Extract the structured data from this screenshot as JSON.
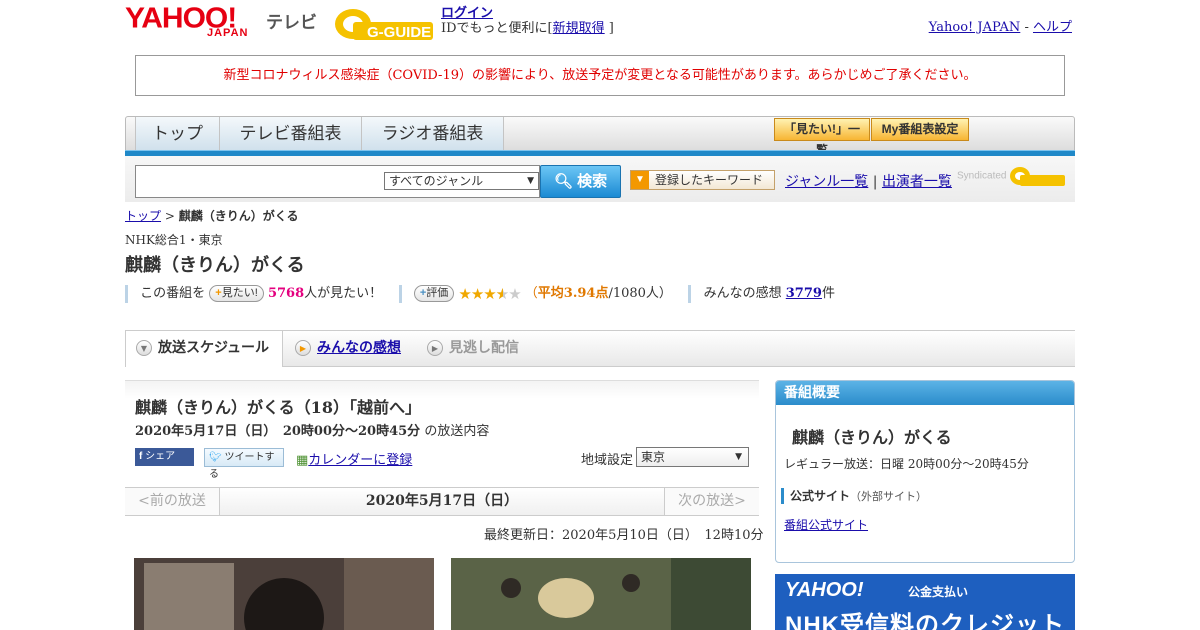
{
  "header": {
    "logo_yahoo": "YAHOO!",
    "logo_japan": "JAPAN",
    "logo_tv": "テレビ",
    "logo_gguide": "G-GUIDE",
    "login": "ログイン",
    "login_sub_prefix": "IDでもっと便利に[",
    "register": "新規取得",
    "login_sub_suffix": "]",
    "yahoo_japan_link": "Yahoo! JAPAN",
    "separator": "-",
    "help_link": "ヘルプ"
  },
  "notice": "新型コロナウィルス感染症（COVID-19）の影響により、放送予定が変更となる可能性があります。あらかじめご了承ください。",
  "nav": {
    "tabs": [
      "トップ",
      "テレビ番組表",
      "ラジオ番組表"
    ],
    "want_list": "「見たい!」一覧",
    "my_schedule": "My番組表設定"
  },
  "search": {
    "input_value": "",
    "genre_selected": "すべてのジャンル",
    "button": "検索",
    "keyword_button": "登録したキーワード",
    "genre_list": "ジャンル一覧",
    "link_sep": "|",
    "performer_list": "出演者一覧",
    "syndicated": "Syndicated"
  },
  "breadcrumb": {
    "top": "トップ",
    "sep": ">",
    "current": "麒麟（きりん）がくる"
  },
  "program": {
    "channel": "NHK総合1・東京",
    "title": "麒麟（きりん）がくる",
    "want_prefix": "この番組を",
    "want_button": "見たい!",
    "want_count": "5768",
    "want_suffix": "人が見たい！",
    "rate_button": "評価",
    "rating_stars": 3.94,
    "avg_open": "（",
    "avg_label": "平均3.94点",
    "avg_count": "/1080人）",
    "impressions_label": "みんなの感想",
    "impressions_count": "3779",
    "impressions_suffix": "件"
  },
  "tabs": {
    "schedule": "放送スケジュール",
    "impressions": "みんなの感想",
    "streaming": "見逃し配信"
  },
  "episode": {
    "title": "麒麟（きりん）がくる（18）「越前へ」",
    "date_time": "2020年5月17日（日）　20時00分～20時45分",
    "date_suffix": "の放送内容",
    "share_fb": "シェア",
    "share_tw": "ツイートする",
    "calendar": "カレンダーに登録",
    "region_label": "地域設定",
    "region_value": "東京",
    "prev": "<前の放送",
    "current_date": "2020年5月17日（日）",
    "next": "次の放送>",
    "updated": "最終更新日：2020年5月10日（日）　12時10分"
  },
  "summary": {
    "header": "番組概要",
    "title": "麒麟（きりん）がくる",
    "regular": "レギュラー放送：日曜 20時00分～20時45分",
    "official_label": "公式サイト",
    "official_note": "（外部サイト）",
    "official_link": "番組公式サイト"
  },
  "ad": {
    "yahoo": "YAHOO!",
    "pay": "公金支払い",
    "text": "NHK受信料のクレジット"
  },
  "colors": {
    "brand_red": "#e60012",
    "nav_blue": "#1f88c8",
    "notice_red": "#e00000",
    "want_pink": "#e4007f",
    "avg_orange": "#e07800"
  }
}
